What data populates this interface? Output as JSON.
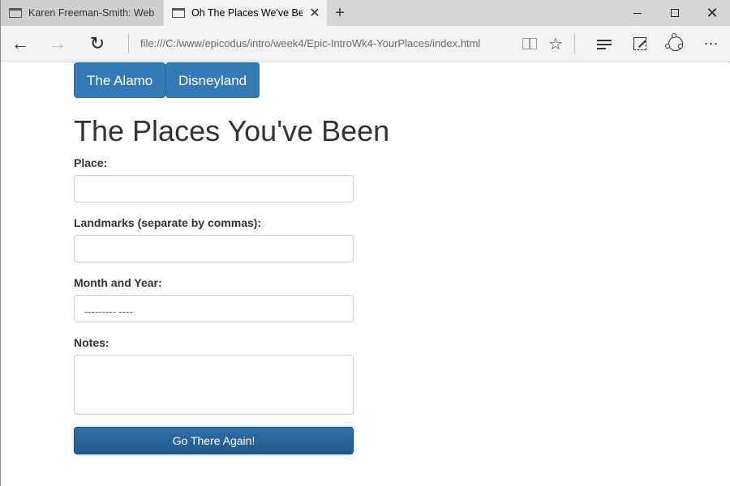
{
  "browser": {
    "tabs": [
      {
        "title": "Karen Freeman-Smith: Web"
      },
      {
        "title": "Oh The Places We've Be",
        "close": "✕"
      }
    ],
    "new_tab": "+",
    "window": {
      "close": "✕"
    },
    "nav": {
      "back": "←",
      "forward": "→",
      "refresh": "↻"
    },
    "url": "file:///C:/www/epicodus/intro/week4/Epic-IntroWk4-YourPlaces/index.html",
    "tools": {
      "favorite": "☆",
      "more": "⋯"
    }
  },
  "page": {
    "place_buttons": [
      "The Alamo",
      "Disneyland"
    ],
    "title": "The Places You've Been",
    "form": {
      "place_label": "Place:",
      "place_value": "",
      "landmarks_label": "Landmarks (separate by commas):",
      "landmarks_value": "",
      "month_label": "Month and Year:",
      "month_placeholder": "--------- ----",
      "notes_label": "Notes:",
      "notes_value": "",
      "submit_label": "Go There Again!"
    }
  },
  "colors": {
    "primary_button": "#337ab7",
    "submit_button": "#245f93",
    "text": "#333333"
  }
}
